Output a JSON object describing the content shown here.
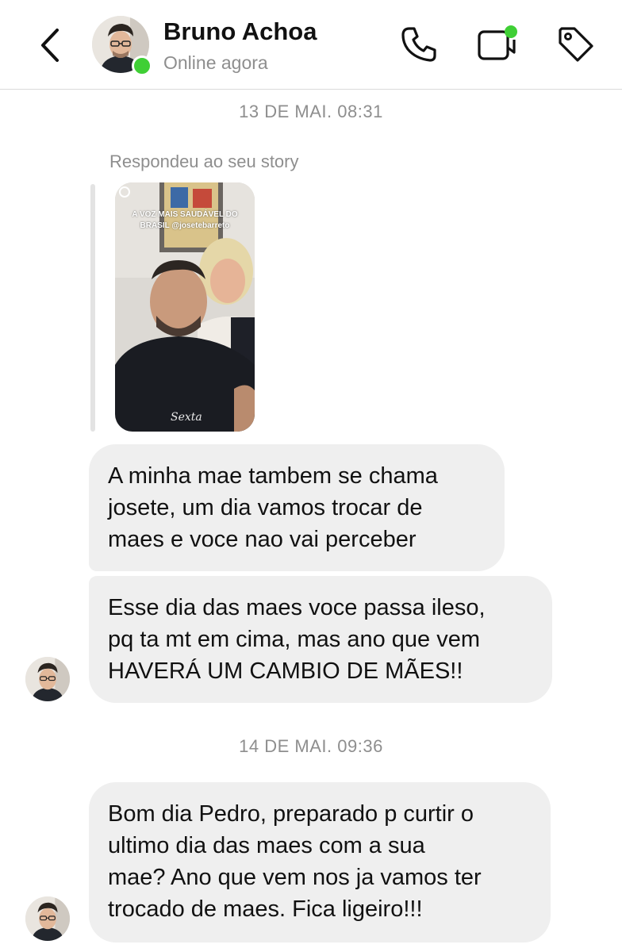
{
  "header": {
    "contact_name": "Bruno Achoa",
    "status": "Online agora",
    "icons": {
      "back": "chevron-left-icon",
      "call": "phone-icon",
      "video": "video-camera-icon",
      "tag": "tag-icon"
    },
    "online_color": "#3fcf35"
  },
  "conversation": {
    "timestamp_1": "13 DE MAI. 08:31",
    "story_reply_label": "Respondeu ao seu story",
    "story_caption_line1": "A VOZ MAIS SAUDÁVEL DO",
    "story_caption_line2": "BRASIL @josetebarreto",
    "messages": [
      {
        "lines": [
          "A minha mae tambem se chama",
          "josete, um dia vamos trocar de",
          "maes e voce nao vai perceber"
        ]
      },
      {
        "lines": [
          "Esse dia das maes voce passa ileso,",
          "pq ta mt em cima, mas ano que vem",
          "HAVERÁ UM CAMBIO DE MÃES!!"
        ]
      },
      {
        "lines": [
          "Bom dia Pedro, preparado p curtir o",
          "ultimo dia das maes com a sua",
          "mae? Ano que vem nos ja vamos ter",
          "trocado de maes. Fica ligeiro!!!"
        ]
      }
    ],
    "timestamp_2": "14 DE MAI. 09:36"
  },
  "colors": {
    "bubble_bg": "#efefef",
    "secondary_text": "#8e8e8e"
  }
}
